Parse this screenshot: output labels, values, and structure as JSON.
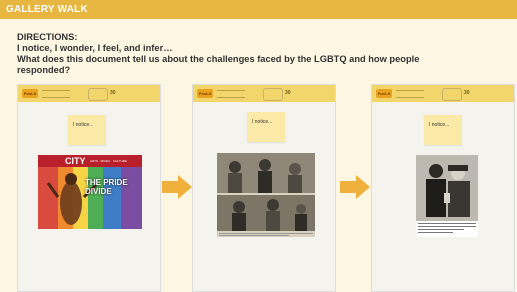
{
  "header": {
    "title": "GALLERY WALK"
  },
  "directions": {
    "heading": "DIRECTIONS:",
    "line1": "I notice, I wonder, I feel, and infer…",
    "line2": "What does this document tell us about the challenges faced by the LGBTQ and how people",
    "line3": "responded?"
  },
  "posters": [
    {
      "sticky_note": "I notice...",
      "brand": "Post-it",
      "pad_count": "30",
      "document": {
        "masthead": "CITY",
        "headline": "THE PRIDE DIVIDE",
        "masthead_sub": "ARTS · MUSIC · CULTURE"
      }
    },
    {
      "sticky_note": "I notice...",
      "brand": "Post-it",
      "pad_count": "30",
      "document": {
        "caption": ""
      }
    },
    {
      "sticky_note": "I notice...",
      "brand": "Post-it",
      "pad_count": "30",
      "document": {
        "caption": ""
      }
    }
  ],
  "colors": {
    "header": "#e6b640",
    "background": "#fdf6e3",
    "arrow": "#f0b13c",
    "poster_top": "#f3d66b",
    "sticky": "#fbe9a8"
  }
}
